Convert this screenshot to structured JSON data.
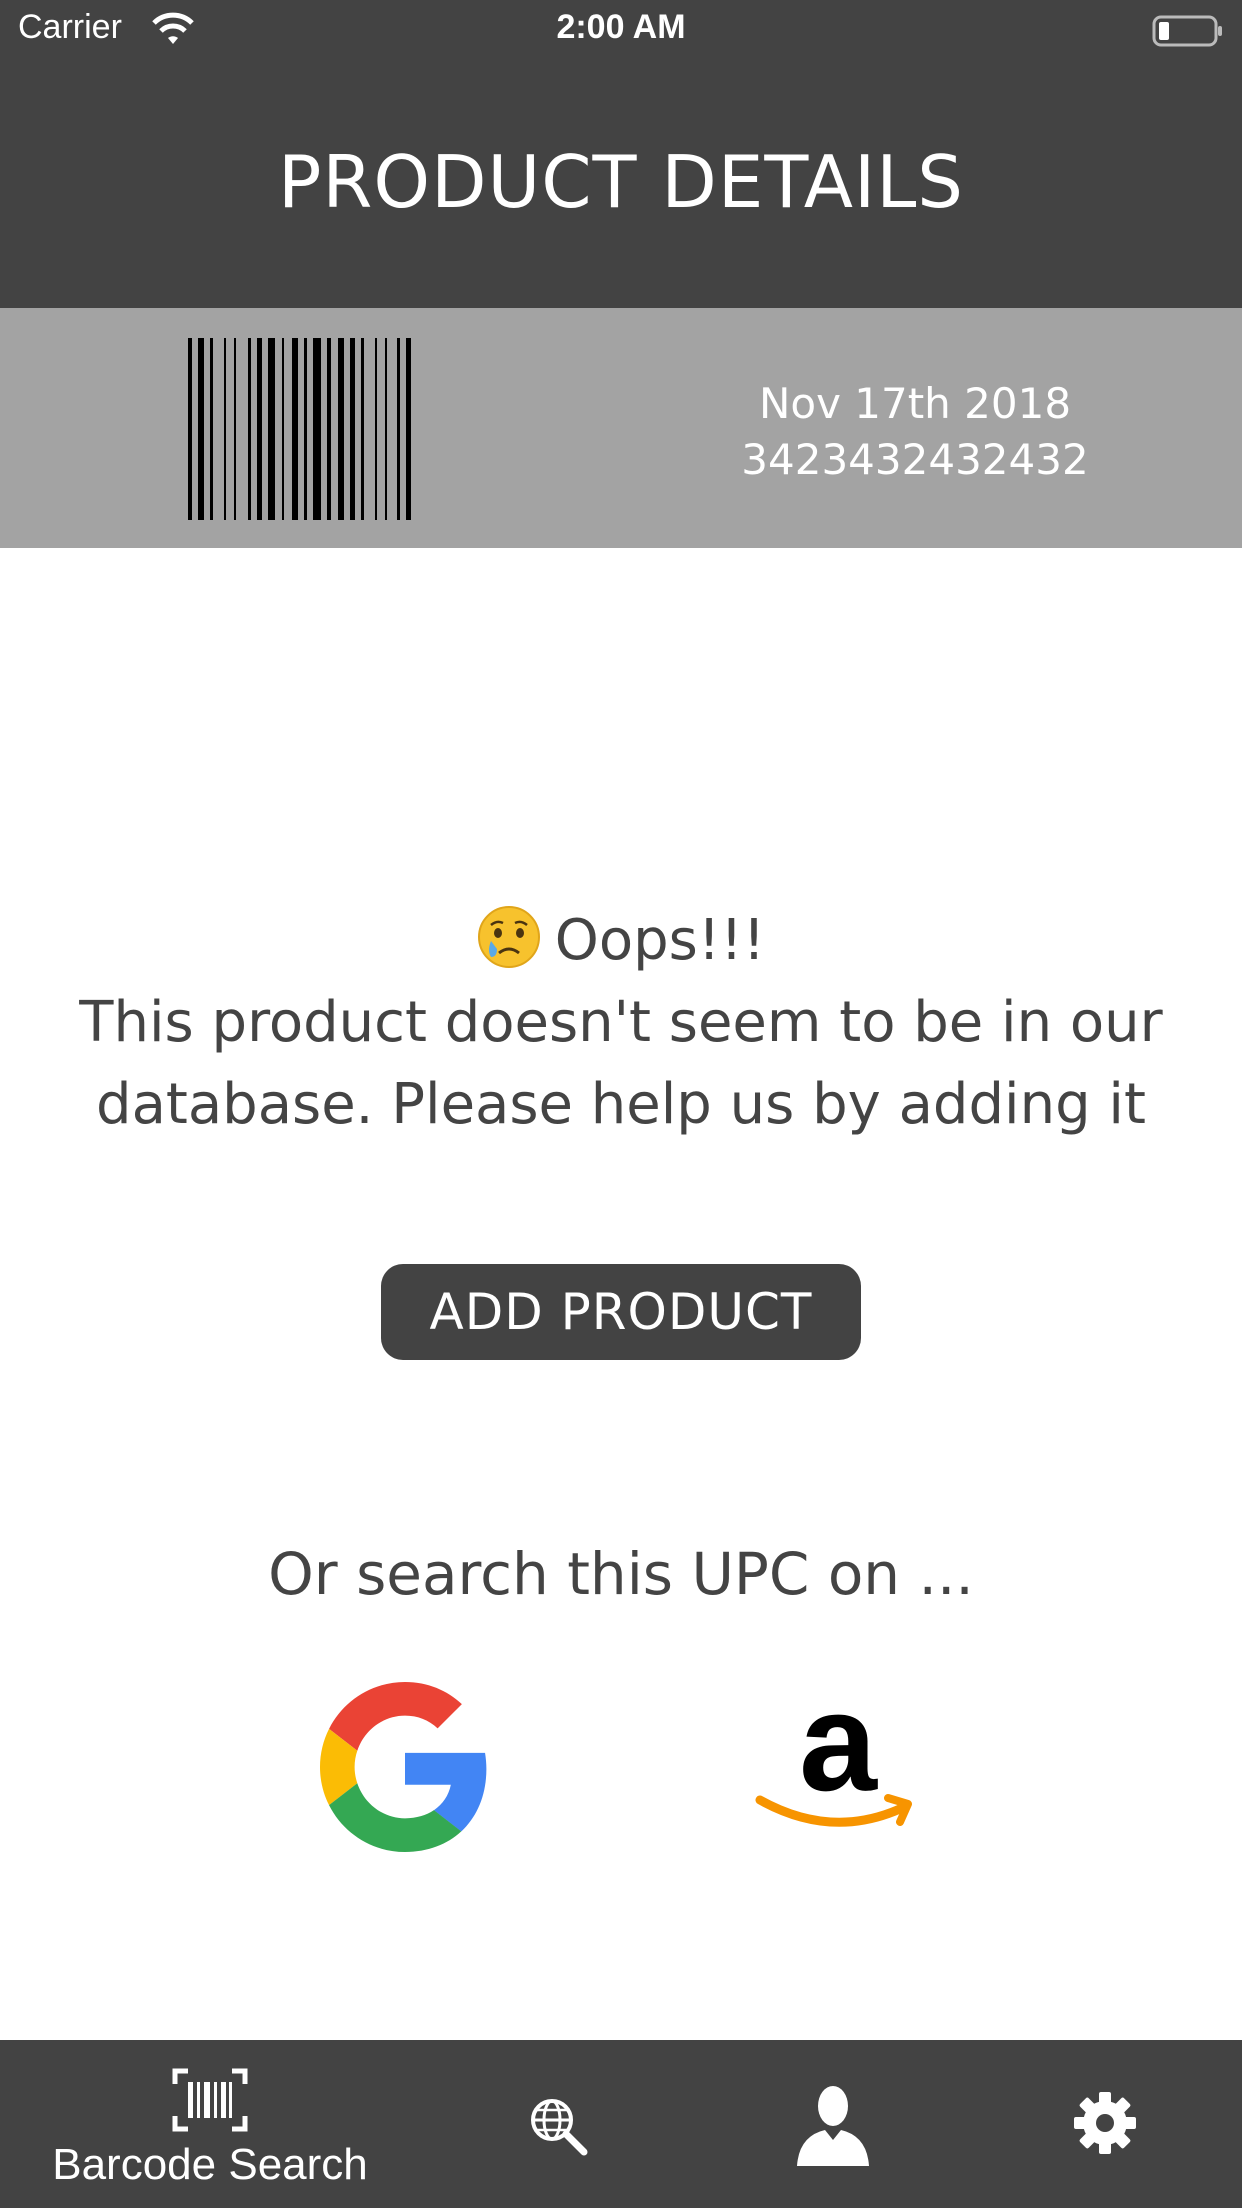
{
  "status_bar": {
    "carrier": "Carrier",
    "time": "2:00 AM"
  },
  "header": {
    "title": "PRODUCT DETAILS"
  },
  "barcode": {
    "date": "Nov 17th 2018",
    "upc": "3423432432432"
  },
  "message": {
    "title": "Oops!!!",
    "line1": "This product doesn't seem to be in our",
    "line2": "database. Please help us by adding it"
  },
  "add_button": {
    "label": "ADD PRODUCT"
  },
  "search": {
    "hint": "Or search this UPC on ...",
    "providers": [
      "google-logo",
      "amazon-logo"
    ]
  },
  "tab_bar": {
    "items": [
      {
        "icon": "barcode-scan-icon",
        "label": "Barcode Search",
        "selected": true
      },
      {
        "icon": "globe-search-icon",
        "label": ""
      },
      {
        "icon": "user-icon",
        "label": ""
      },
      {
        "icon": "gear-icon",
        "label": ""
      }
    ]
  },
  "colors": {
    "header_bg": "#434343",
    "barcode_strip_bg": "#a3a3a3",
    "text_dark": "#444444",
    "button_bg": "#434343",
    "white": "#ffffff"
  }
}
